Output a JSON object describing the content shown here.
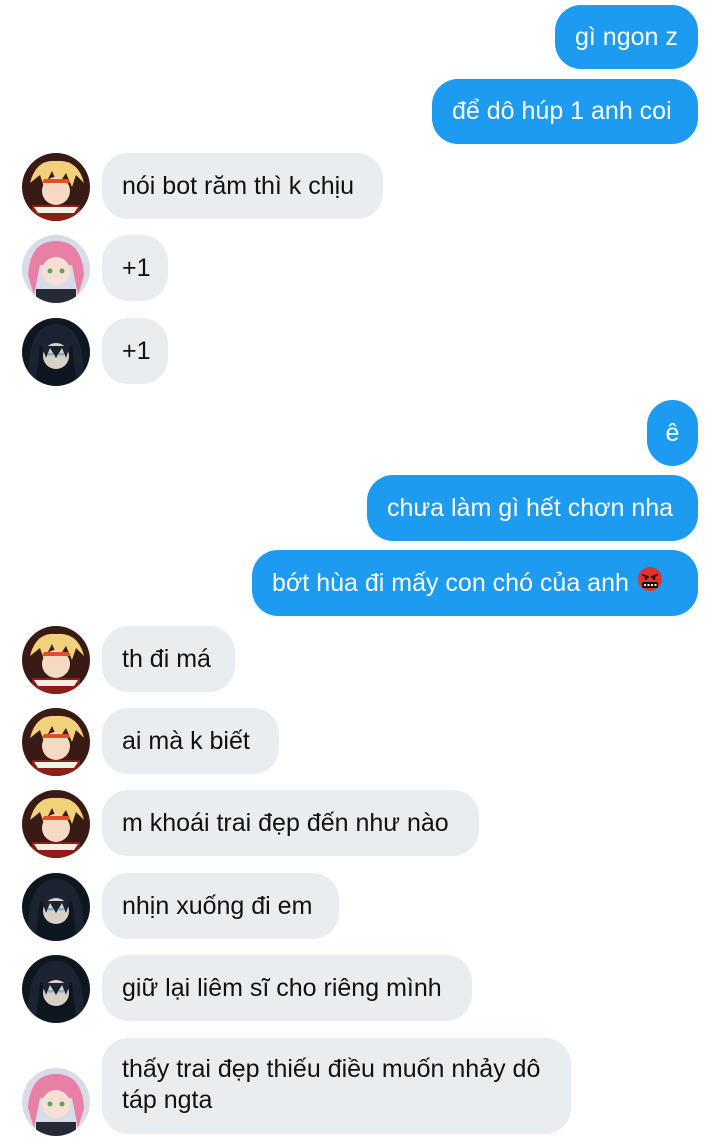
{
  "messages": [
    {
      "id": "m1",
      "side": "out",
      "text": "gì ngon z"
    },
    {
      "id": "m2",
      "side": "out",
      "text": "để dô húp 1 anh coi"
    },
    {
      "id": "m3",
      "side": "in",
      "avatar": "avatar-blonde-flame-hair",
      "text": "nói bot răm thì k chịu"
    },
    {
      "id": "m4",
      "side": "in",
      "avatar": "avatar-pink-hair",
      "text": "+1"
    },
    {
      "id": "m5",
      "side": "in",
      "avatar": "avatar-dark-hair",
      "text": "+1"
    },
    {
      "id": "m6",
      "side": "out",
      "text": "ê"
    },
    {
      "id": "m7",
      "side": "out",
      "text": "chưa làm gì hết chơn nha"
    },
    {
      "id": "m8",
      "side": "out",
      "text": "bớt hùa đi mấy con chó của anh",
      "emoji": "face-with-symbols-on-mouth-icon"
    },
    {
      "id": "m9",
      "side": "in",
      "avatar": "avatar-blonde-flame-hair",
      "text": "th đi má"
    },
    {
      "id": "m10",
      "side": "in",
      "avatar": "avatar-blonde-flame-hair",
      "text": "ai mà k biết"
    },
    {
      "id": "m11",
      "side": "in",
      "avatar": "avatar-blonde-flame-hair",
      "text": "m khoái trai đẹp đến như nào"
    },
    {
      "id": "m12",
      "side": "in",
      "avatar": "avatar-dark-hair",
      "text": "nhịn xuống đi em"
    },
    {
      "id": "m13",
      "side": "in",
      "avatar": "avatar-dark-hair",
      "text": "giữ lại liêm sĩ cho riêng mình"
    },
    {
      "id": "m14",
      "side": "in",
      "avatar": "avatar-pink-hair",
      "text": "thấy trai đẹp thiếu điều muốn nhảy dô táp ngta"
    }
  ],
  "colors": {
    "outgoing_bubble": "#1d9bf0",
    "incoming_bubble": "#e9edf0",
    "background": "#ffffff"
  }
}
